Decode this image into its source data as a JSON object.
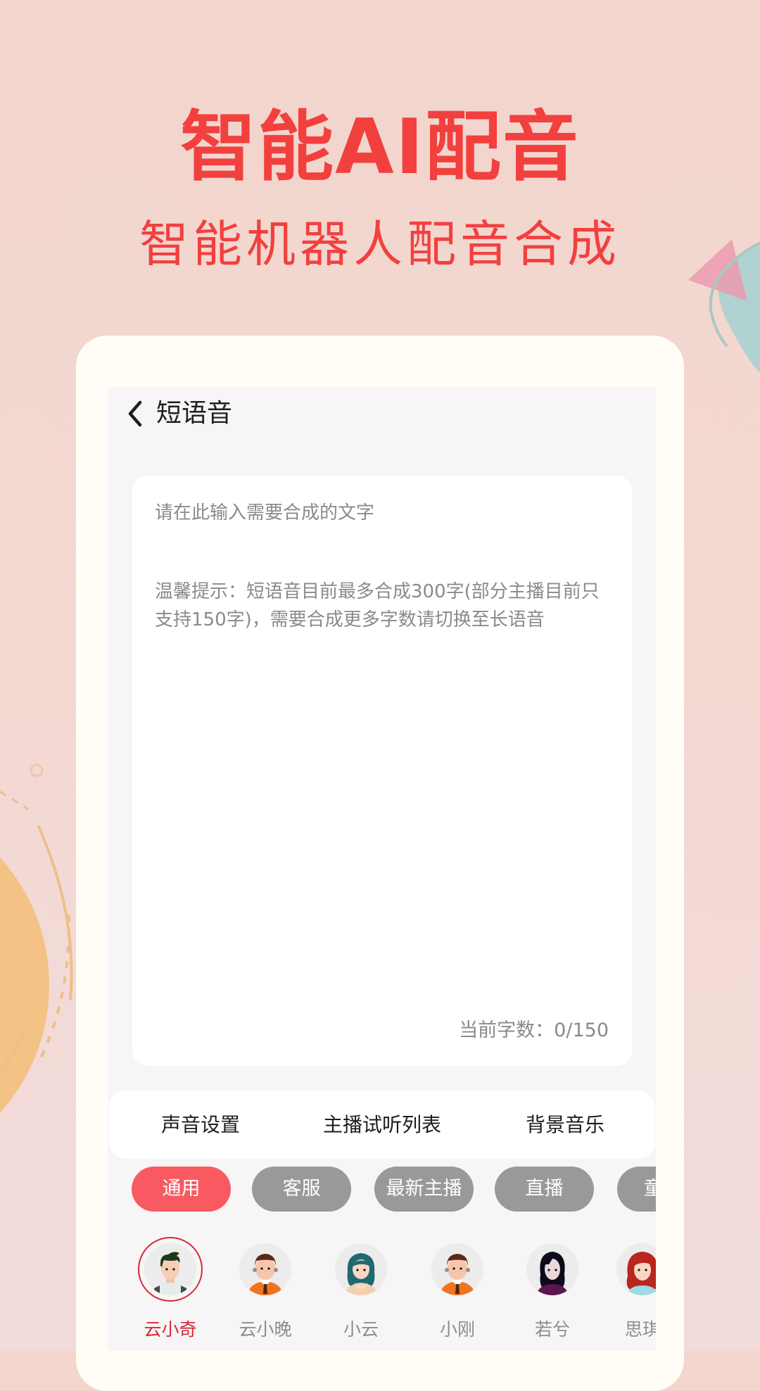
{
  "hero": {
    "title": "智能AI配音",
    "subtitle": "智能机器人配音合成"
  },
  "colors": {
    "accent_red": "#f2403f",
    "chip_active": "#f95a62",
    "chip_inactive": "#9a9898",
    "selected_ring": "#d22a36",
    "background": "#f2d6cd"
  },
  "nav": {
    "back_icon": "chevron-left-icon",
    "title": "短语音"
  },
  "editor": {
    "placeholder": "请在此输入需要合成的文字",
    "value": "",
    "hint": "温馨提示：短语音目前最多合成300字(部分主播目前只支持150字)，需要合成更多字数请切换至长语音",
    "counter_label": "当前字数：",
    "counter_current": "0",
    "counter_max": "150",
    "counter_text": "当前字数：0/150"
  },
  "tabs": [
    {
      "label": "声音设置"
    },
    {
      "label": "主播试听列表"
    },
    {
      "label": "背景音乐"
    }
  ],
  "categories": [
    {
      "label": "通用",
      "active": true
    },
    {
      "label": "客服",
      "active": false
    },
    {
      "label": "最新主播",
      "active": false
    },
    {
      "label": "直播",
      "active": false
    },
    {
      "label": "童",
      "active": false
    }
  ],
  "voices": [
    {
      "name": "云小奇",
      "selected": true,
      "avatar": "male-avatar-icon"
    },
    {
      "name": "云小晚",
      "selected": false,
      "avatar": "male-avatar-icon"
    },
    {
      "name": "小云",
      "selected": false,
      "avatar": "female-avatar-icon"
    },
    {
      "name": "小刚",
      "selected": false,
      "avatar": "male-avatar-icon"
    },
    {
      "name": "若兮",
      "selected": false,
      "avatar": "female-avatar-icon"
    },
    {
      "name": "思琪",
      "selected": false,
      "avatar": "female-avatar-icon"
    }
  ]
}
